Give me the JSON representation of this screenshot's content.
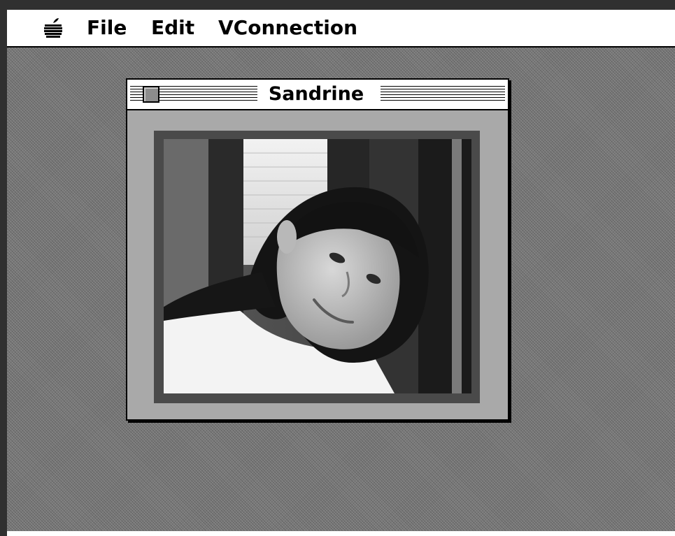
{
  "menubar": {
    "apple_icon": "apple-icon",
    "items": [
      {
        "label": "File"
      },
      {
        "label": "Edit"
      },
      {
        "label": "VConnection"
      }
    ]
  },
  "window": {
    "title": "Sandrine",
    "close_icon": "close-box-icon",
    "content": "portrait photo of a smiling woman with dark hair"
  },
  "colors": {
    "desktop": "#7a7a7a",
    "window_body": "#a9a9a9",
    "frame": "#4a4a4a",
    "bezel": "#303030"
  }
}
